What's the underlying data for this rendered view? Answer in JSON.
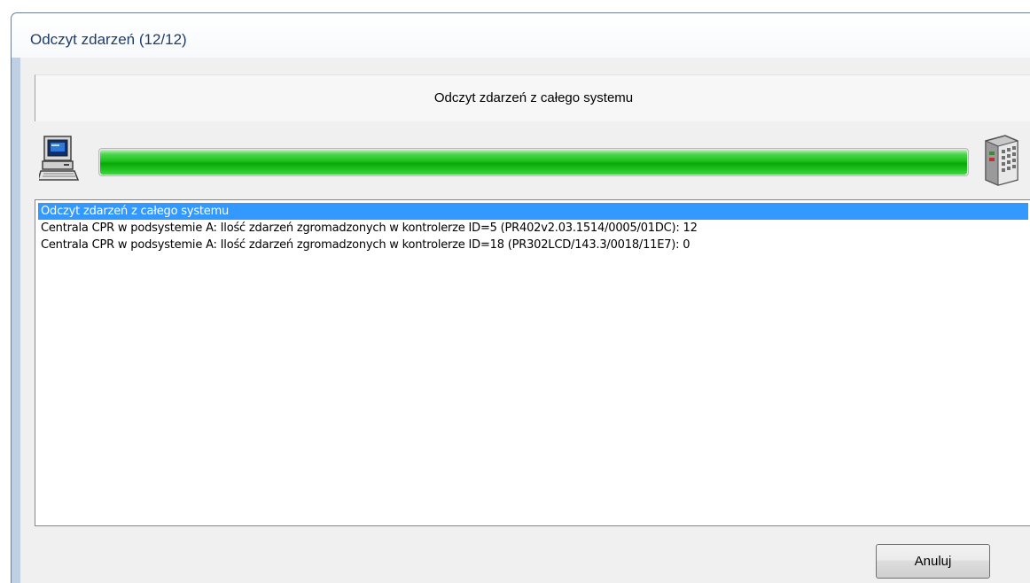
{
  "window": {
    "title": "Odczyt zdarzeń  (12/12)"
  },
  "header": {
    "text": "Odczyt zdarzeń z całego systemu"
  },
  "progress": {
    "value": 1.0,
    "color": "#1cc21c"
  },
  "icons": {
    "left": "computer-icon",
    "right": "access-controller-icon"
  },
  "log": {
    "items": [
      "Odczyt zdarzeń z całego systemu",
      "Centrala CPR w podsystemie A: Ilość zdarzeń zgromadzonych w kontrolerze ID=5 (PR402v2.03.1514/0005/01DC): 12",
      "Centrala CPR w podsystemie A: Ilość zdarzeń zgromadzonych w kontrolerze ID=18 (PR302LCD/143.3/0018/11E7): 0"
    ],
    "selected_index": 0,
    "selection_color": "#3399ff"
  },
  "buttons": {
    "cancel_label": "Anuluj"
  }
}
